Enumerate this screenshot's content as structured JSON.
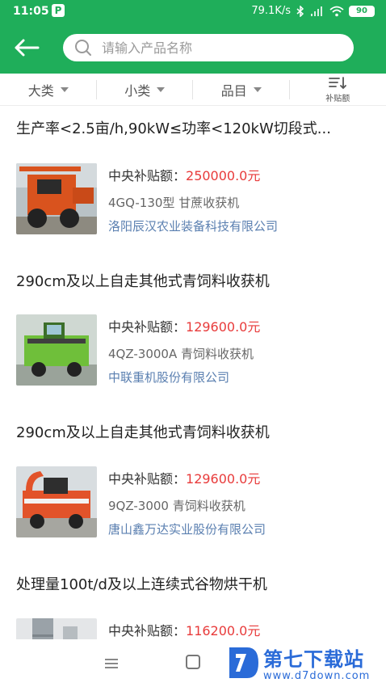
{
  "status": {
    "time": "11:05",
    "p_badge": "P",
    "network_speed": "79.1K/s",
    "battery": "90"
  },
  "search": {
    "placeholder": "请输入产品名称",
    "value": ""
  },
  "filters": [
    {
      "label": "大类",
      "icon": "caret-down-icon"
    },
    {
      "label": "小类",
      "icon": "caret-down-icon"
    },
    {
      "label": "品目",
      "icon": "caret-down-icon"
    },
    {
      "label": "补贴额",
      "icon": "sort-icon"
    }
  ],
  "items": [
    {
      "title": "生产率<2.5亩/h,90kW≤功率<120kW切段式...",
      "subsidy_label": "中央补贴额：",
      "subsidy_amount": "250000.0元",
      "model": "4GQ-130型 甘蔗收获机",
      "company": "洛阳辰汉农业装备科技有限公司"
    },
    {
      "title": "290cm及以上自走其他式青饲料收获机",
      "subsidy_label": "中央补贴额：",
      "subsidy_amount": "129600.0元",
      "model": "4QZ-3000A 青饲料收获机",
      "company": "中联重机股份有限公司"
    },
    {
      "title": "290cm及以上自走其他式青饲料收获机",
      "subsidy_label": "中央补贴额：",
      "subsidy_amount": "129600.0元",
      "model": "9QZ-3000 青饲料收获机",
      "company": "唐山鑫万达实业股份有限公司"
    },
    {
      "title": "处理量100t/d及以上连续式谷物烘干机",
      "subsidy_label": "中央补贴额：",
      "subsidy_amount": "116200.0元",
      "model": "",
      "company": ""
    }
  ],
  "watermark": {
    "name": "第七下载站",
    "url": "www.d7down.com"
  },
  "colors": {
    "brand_green": "#1fae5a",
    "amount_red": "#e83b3b",
    "company_blue": "#5a7fb0"
  }
}
